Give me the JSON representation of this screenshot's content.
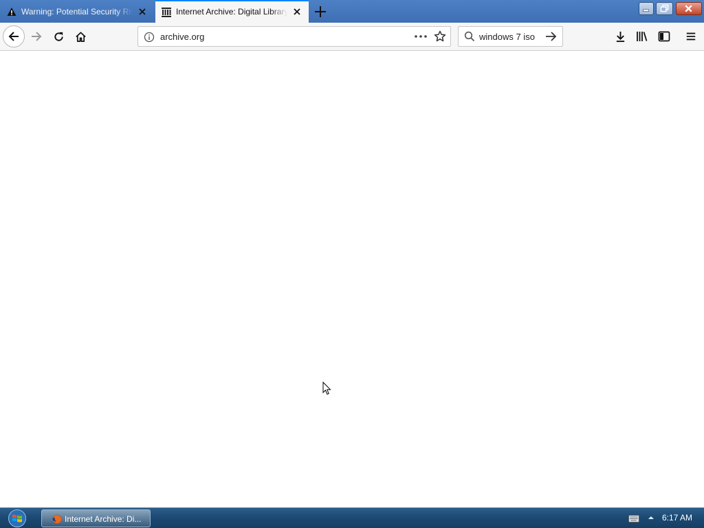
{
  "browser": {
    "tabs": [
      {
        "title": "Warning: Potential Security Risk Ahead",
        "icon": "warning-icon",
        "active": false
      },
      {
        "title": "Internet Archive: Digital Library of Free & Borrowable Books",
        "icon": "archive-icon",
        "active": true
      }
    ],
    "url": "archive.org",
    "search_query": "windows 7 iso",
    "accent_color": "#0a84ff"
  },
  "toolbar": {
    "icons": [
      "back-icon",
      "forward-icon",
      "reload-icon",
      "home-icon",
      "downloads-icon",
      "library-icon",
      "sidebar-icon",
      "menu-icon"
    ]
  },
  "taskbar": {
    "window_label": "Internet Archive: Di...",
    "clock": "6:17 AM"
  }
}
